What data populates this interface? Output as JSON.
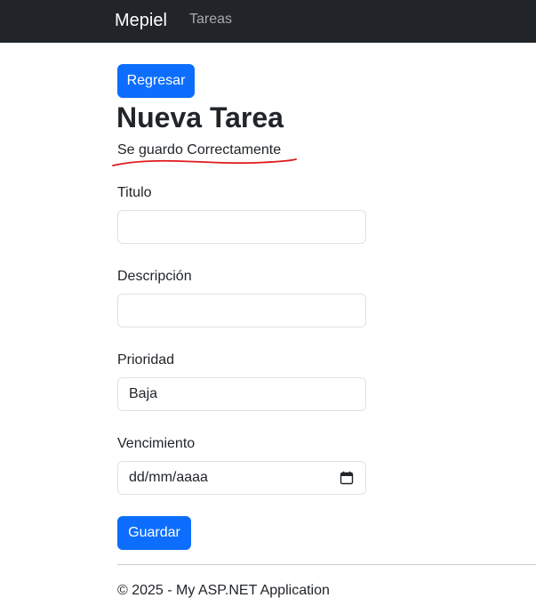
{
  "navbar": {
    "brand": "Mepiel",
    "links": [
      "Tareas"
    ]
  },
  "page": {
    "back_button": "Regresar",
    "title": "Nueva Tarea",
    "status_message": "Se guardo Correctamente"
  },
  "form": {
    "titulo": {
      "label": "Titulo",
      "value": ""
    },
    "descripcion": {
      "label": "Descripción",
      "value": ""
    },
    "prioridad": {
      "label": "Prioridad",
      "value": "Baja"
    },
    "vencimiento": {
      "label": "Vencimiento",
      "placeholder": "dd/mm/aaaa",
      "icon": "calendar-icon"
    },
    "save_button": "Guardar"
  },
  "footer": {
    "text": "© 2025 - My ASP.NET Application"
  },
  "colors": {
    "navbar_bg": "#212529",
    "primary": "#0d6efd",
    "annotation": "#e0191b"
  }
}
